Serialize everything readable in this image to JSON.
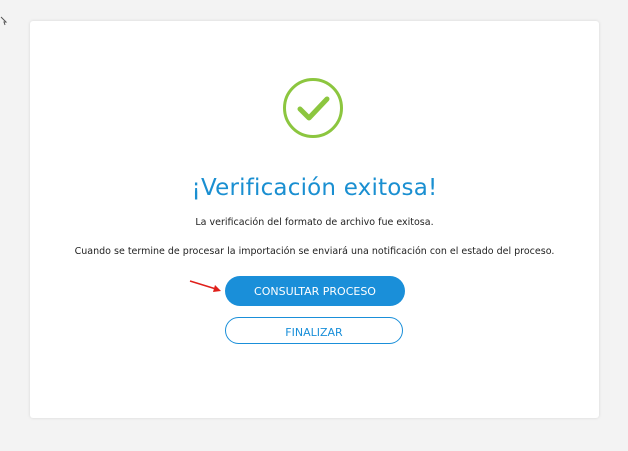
{
  "dialog": {
    "title": "¡Verificación exitosa!",
    "message": "La verificación del formato de archivo fue exitosa.",
    "notice": "Cuando se termine de procesar la importación se enviará una notificación con el estado del proceso.",
    "primary_button": "CONSULTAR PROCESO",
    "secondary_button": "FINALIZAR"
  },
  "icons": {
    "success": "check-circle-icon",
    "pointer": "red-arrow-icon"
  },
  "colors": {
    "accent": "#1a8fd9",
    "success": "#8cc63f",
    "arrow": "#e0201b"
  }
}
